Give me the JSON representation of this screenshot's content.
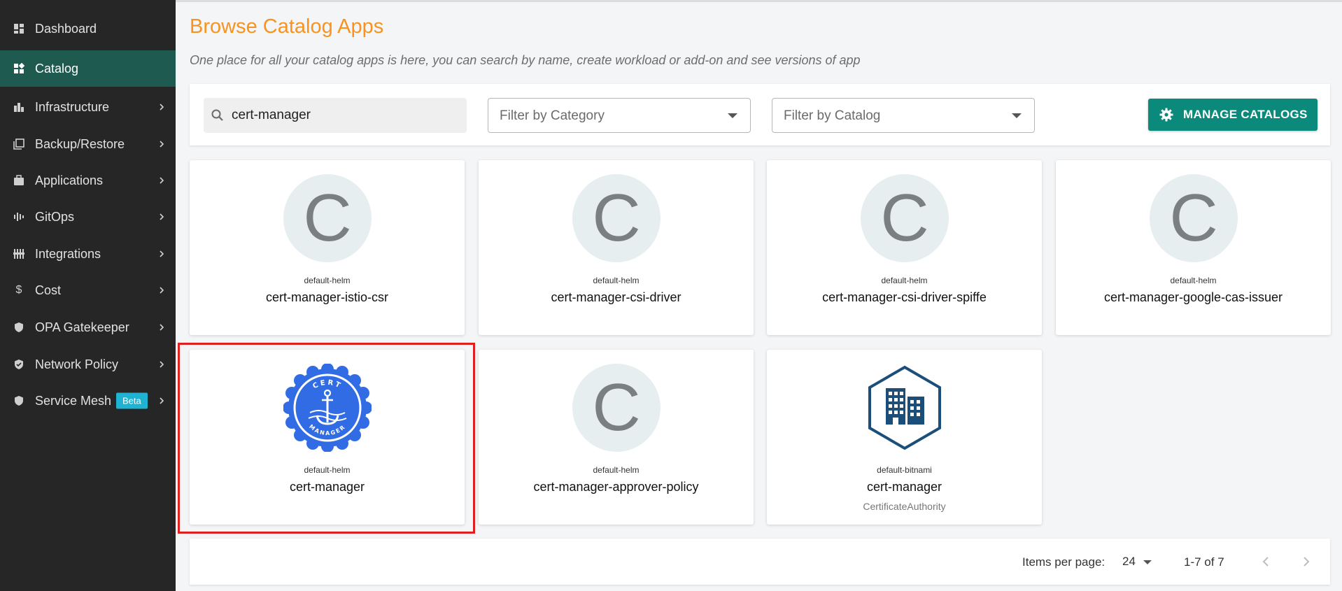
{
  "sidebar": {
    "items": [
      {
        "label": "Dashboard",
        "icon": "dashboard-icon",
        "active": false,
        "has_chevron": false
      },
      {
        "label": "Catalog",
        "icon": "catalog-icon",
        "active": true,
        "has_chevron": false
      },
      {
        "label": "Infrastructure",
        "icon": "infrastructure-icon",
        "active": false,
        "has_chevron": true
      },
      {
        "label": "Backup/Restore",
        "icon": "backup-icon",
        "active": false,
        "has_chevron": true
      },
      {
        "label": "Applications",
        "icon": "briefcase-icon",
        "active": false,
        "has_chevron": true
      },
      {
        "label": "GitOps",
        "icon": "gitops-icon",
        "active": false,
        "has_chevron": true
      },
      {
        "label": "Integrations",
        "icon": "integrations-icon",
        "active": false,
        "has_chevron": true
      },
      {
        "label": "Cost",
        "icon": "dollar-icon",
        "active": false,
        "has_chevron": true
      },
      {
        "label": "OPA Gatekeeper",
        "icon": "shield-icon",
        "active": false,
        "has_chevron": true
      },
      {
        "label": "Network Policy",
        "icon": "shield-check-icon",
        "active": false,
        "has_chevron": true
      },
      {
        "label": "Service Mesh",
        "icon": "shield-icon",
        "active": false,
        "has_chevron": true,
        "badge": "Beta"
      }
    ]
  },
  "header": {
    "title": "Browse Catalog Apps",
    "subtitle": "One place for all your catalog apps is here, you can search by name, create workload or add-on and see versions of app"
  },
  "toolbar": {
    "search_value": "cert-manager",
    "category_placeholder": "Filter by Category",
    "catalog_placeholder": "Filter by Catalog",
    "manage_label": "MANAGE CATALOGS"
  },
  "cards": [
    {
      "repo": "default-helm",
      "name": "cert-manager-istio-csr",
      "logo": "C"
    },
    {
      "repo": "default-helm",
      "name": "cert-manager-csi-driver",
      "logo": "C"
    },
    {
      "repo": "default-helm",
      "name": "cert-manager-csi-driver-spiffe",
      "logo": "C"
    },
    {
      "repo": "default-helm",
      "name": "cert-manager-google-cas-issuer",
      "logo": "C"
    },
    {
      "repo": "default-helm",
      "name": "cert-manager",
      "logo_text_top": "CERT",
      "logo_text_bottom": "MANAGER"
    },
    {
      "repo": "default-helm",
      "name": "cert-manager-approver-policy",
      "logo": "C"
    },
    {
      "repo": "default-bitnami",
      "name": "cert-manager",
      "description": "CertificateAuthority"
    }
  ],
  "paginator": {
    "items_per_page_label": "Items per page:",
    "items_per_page": "24",
    "range": "1-7 of 7"
  },
  "colors": {
    "accent_title": "#f7931e",
    "sidebar_bg": "#262626",
    "sidebar_active": "#1f5a50",
    "button_teal": "#0b8a7c",
    "highlight_border": "#e02020",
    "cert_manager_blue": "#326ce5",
    "bitnami_navy": "#1b4f7a"
  }
}
